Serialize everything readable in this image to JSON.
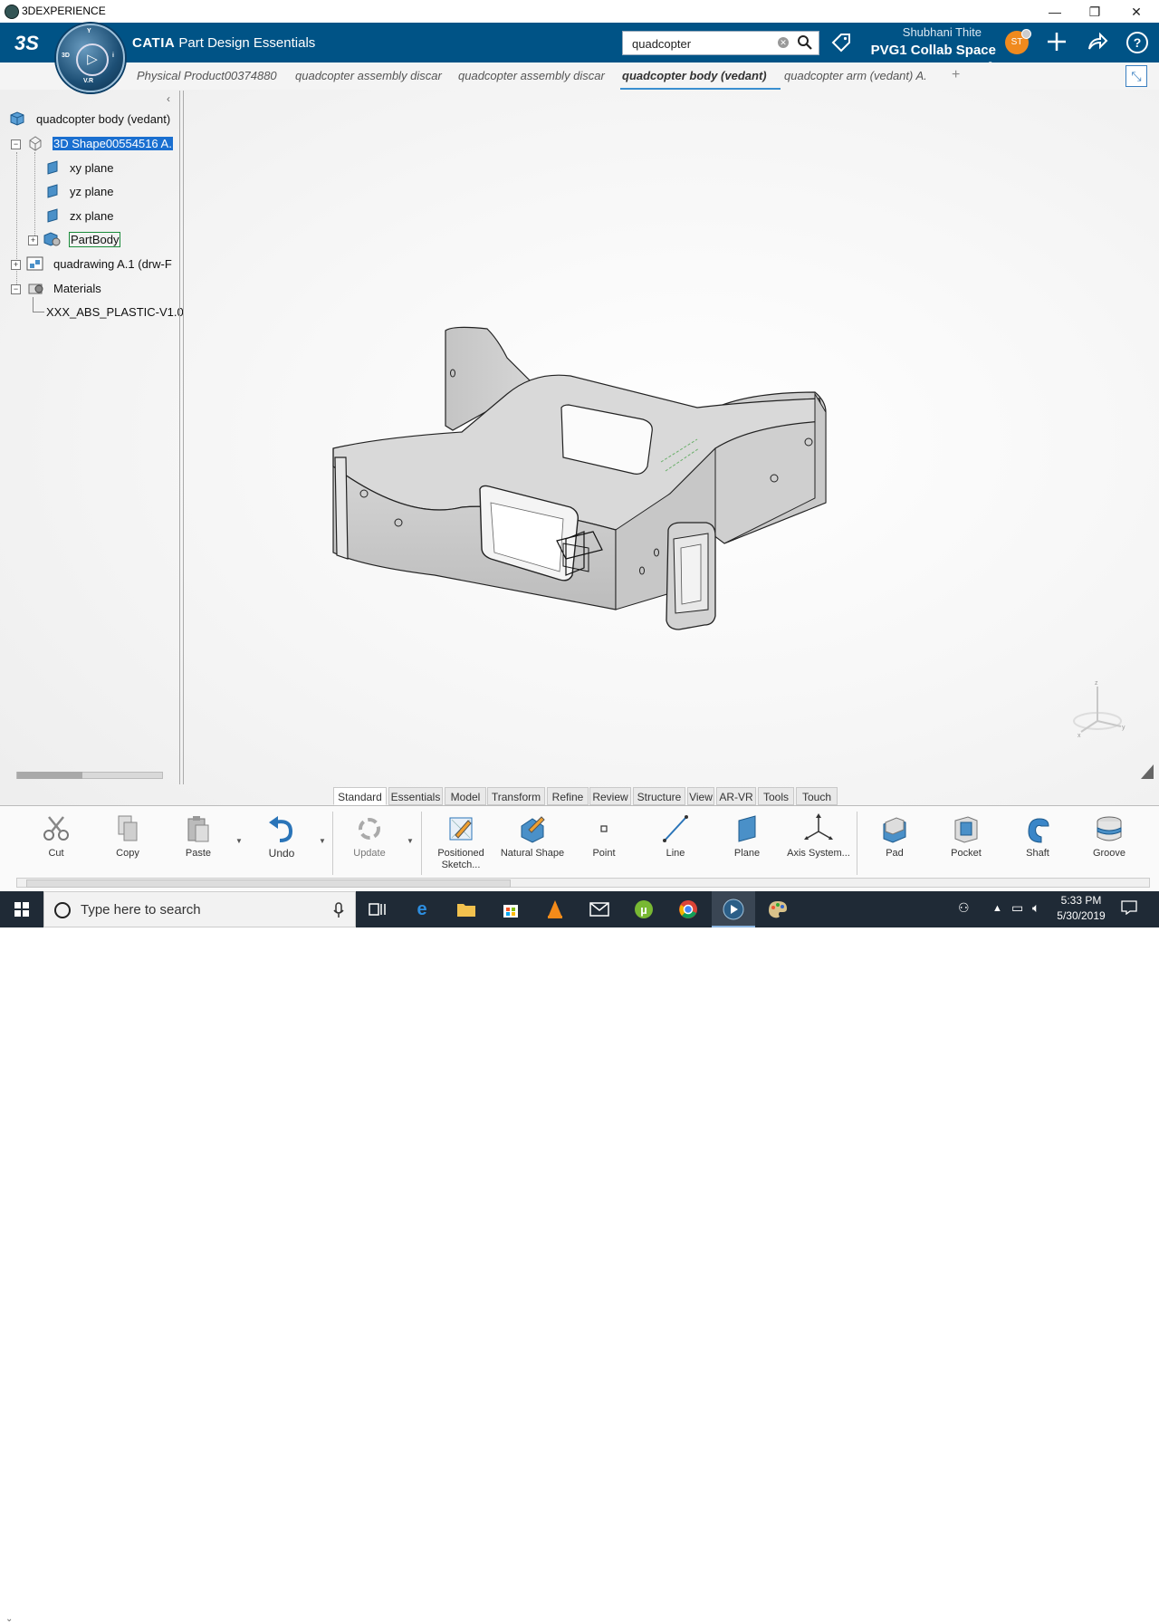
{
  "window": {
    "title": "3DEXPERIENCE",
    "minimize": "—",
    "maximize": "❐",
    "close": "✕"
  },
  "topbar": {
    "brand_logo": "3S",
    "app_prefix": "CATIA",
    "app_name": "Part Design Essentials",
    "compass": {
      "top": "Y",
      "left": "3D",
      "right": "i",
      "bottom": "V.R"
    },
    "search_value": "quadcopter",
    "user_name": "Shubhani Thite",
    "collab_space": "PVG1 Collab Space",
    "avatar_initials": "ST",
    "icons": [
      "tag-icon",
      "plus-icon",
      "share-icon",
      "help-icon"
    ]
  },
  "tabs": [
    {
      "label": "Physical Product00374880",
      "active": false
    },
    {
      "label": "quadcopter assembly discar",
      "active": false
    },
    {
      "label": "quadcopter assembly discar",
      "active": false
    },
    {
      "label": "quadcopter body (vedant)",
      "active": true
    },
    {
      "label": "quadcopter arm (vedant) A.",
      "active": false
    }
  ],
  "tree": {
    "root": "quadcopter body (vedant)",
    "shape": "3D Shape00554516 A.",
    "planes": [
      "xy plane",
      "yz plane",
      "zx plane"
    ],
    "partbody": "PartBody",
    "drawing": "quadrawing A.1 (drw-F",
    "materials": "Materials",
    "material_item": "XXX_ABS_PLASTIC-V1.0"
  },
  "section_tabs": [
    "Standard",
    "Essentials",
    "Model",
    "Transform",
    "Refine",
    "Review",
    "Structure",
    "View",
    "AR-VR",
    "Tools",
    "Touch"
  ],
  "active_section": "Standard",
  "commands": {
    "cut": "Cut",
    "copy": "Copy",
    "paste": "Paste",
    "undo": "Undo",
    "update": "Update",
    "positioned_sketch": "Positioned Sketch...",
    "natural_shape": "Natural Shape",
    "point": "Point",
    "line": "Line",
    "plane": "Plane",
    "axis_system": "Axis System...",
    "pad": "Pad",
    "pocket": "Pocket",
    "shaft": "Shaft",
    "groove": "Groove"
  },
  "taskbar": {
    "search_placeholder": "Type here to search",
    "time": "5:33 PM",
    "date": "5/30/2019"
  },
  "colors": {
    "brand_blue": "#005386",
    "selection": "#1a6fd0",
    "accent": "#3a8fd0"
  }
}
